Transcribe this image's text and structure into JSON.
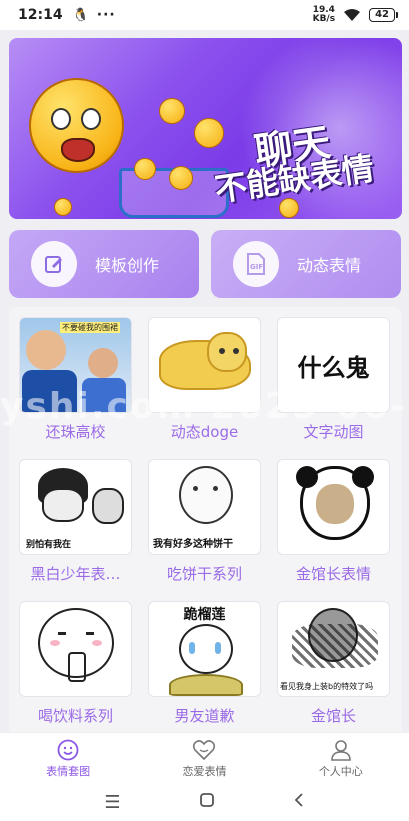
{
  "status_bar": {
    "time": "12:14",
    "net_speed_value": "19.4",
    "net_speed_unit": "KB/s",
    "battery": "42"
  },
  "banner": {
    "line1": "聊天",
    "line2": "不能缺表情"
  },
  "actions": {
    "template_create": "模板创作",
    "animated_emoji": "动态表情"
  },
  "grid": [
    {
      "label": "还珠高校",
      "caption": "不要碰我的围裙"
    },
    {
      "label": "动态doge",
      "caption": ""
    },
    {
      "label": "文字动图",
      "caption": "什么鬼"
    },
    {
      "label": "黑白少年表…",
      "caption": "别怕有我在"
    },
    {
      "label": "吃饼干系列",
      "caption": "我有好多这种饼干"
    },
    {
      "label": "金馆长表情",
      "caption": ""
    },
    {
      "label": "喝饮料系列",
      "caption": ""
    },
    {
      "label": "男友道歉",
      "caption": "跪榴莲"
    },
    {
      "label": "金馆长",
      "caption": "看见我身上装b的特效了吗"
    }
  ],
  "watermark": "yshi.com  2025-06-",
  "bottom_nav": {
    "tab1": "表情套图",
    "tab2": "恋爱表情",
    "tab3": "个人中心"
  },
  "colors": {
    "accent": "#9b6be7",
    "active_tab": "#8c56e6",
    "banner_purple": "#7b3be8"
  }
}
